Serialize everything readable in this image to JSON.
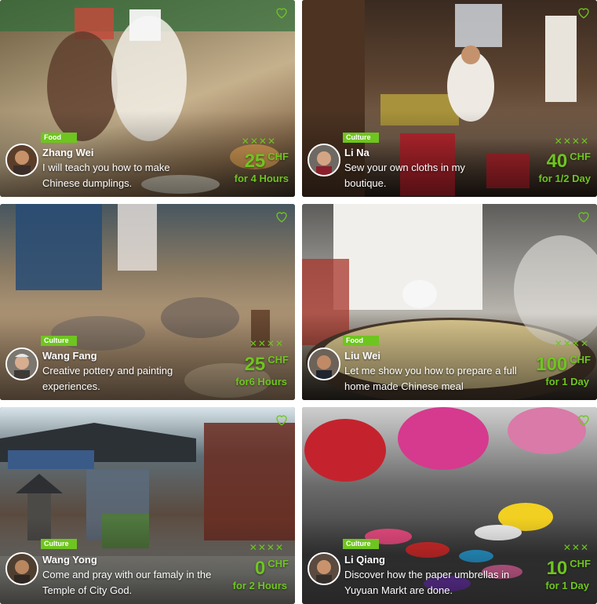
{
  "colors": {
    "accent": "#6ec51f",
    "text": "#ffffff"
  },
  "cards": [
    {
      "category": "Food",
      "host": "Zhang Wei",
      "description": "I will teach you how to make Chinese dumplings.",
      "marks": "✕✕✕✕",
      "price": "25",
      "currency": "CHF",
      "duration": "for 4 Hours",
      "icon": "heart-icon"
    },
    {
      "category": "Culture",
      "host": "Li Na",
      "description": "Sew your own cloths in my boutique.",
      "marks": "✕✕✕✕",
      "price": "40",
      "currency": "CHF",
      "duration": "for 1/2 Day",
      "icon": "heart-icon"
    },
    {
      "category": "Culture",
      "host": "Wang Fang",
      "description": "Creative pottery and painting experiences.",
      "marks": "✕✕✕✕",
      "price": "25",
      "currency": "CHF",
      "duration": "for6 Hours",
      "icon": "heart-icon"
    },
    {
      "category": "Food",
      "host": "Liu Wei",
      "description": "Let me show you how to prepare a full home made Chinese meal",
      "marks": "✕✕✕✕",
      "price": "100",
      "currency": "CHF",
      "duration": "for 1 Day",
      "icon": "heart-icon"
    },
    {
      "category": "Culture",
      "host": "Wang Yong",
      "description": "Come and pray with our famaly in the Temple of City God.",
      "marks": "✕✕✕✕",
      "price": "0",
      "currency": "CHF",
      "duration": "for 2 Hours",
      "icon": "heart-icon"
    },
    {
      "category": "Culture",
      "host": "Li Qiang",
      "description": "Discover how the paper umbrellas in Yuyuan Markt are done.",
      "marks": "✕✕✕",
      "price": "10",
      "currency": "CHF",
      "duration": "for 1 Day",
      "icon": "heart-icon"
    }
  ]
}
